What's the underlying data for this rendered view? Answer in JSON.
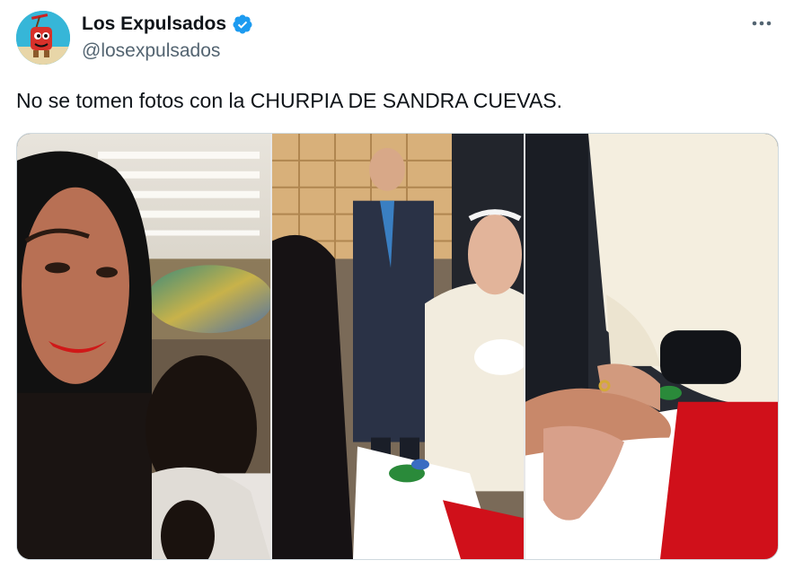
{
  "author": {
    "display_name": "Los Expulsados",
    "handle": "@losexpulsados",
    "avatar_icon": "cartoon-mascot-avatar",
    "verified_icon": "verified-badge-icon",
    "verified_color": "#1d9bf0"
  },
  "more_icon": "more-options-icon",
  "tweet": {
    "text": "No se tomen fotos con la CHURPIA DE SANDRA CUEVAS."
  },
  "media": {
    "panel_count": 3
  }
}
